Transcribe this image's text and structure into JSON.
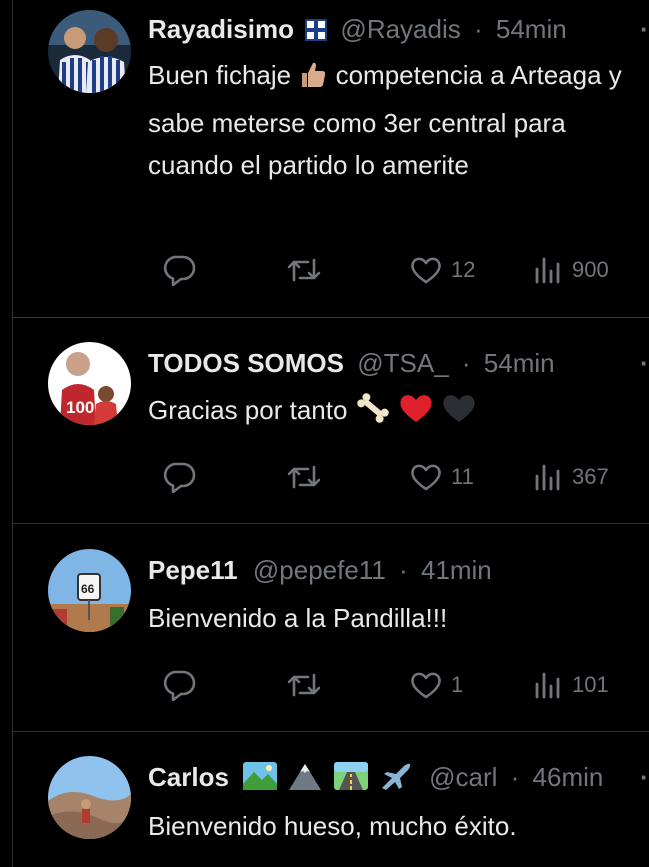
{
  "tweets": [
    {
      "name": "Rayadisimo",
      "handle": "@Rayadis",
      "dot": "·",
      "time": "54min",
      "text_a": "Buen fichaje",
      "text_b": "competencia a Arteaga y sabe meterse como 3er central para cuando el partido lo amerite",
      "replies": "",
      "retweets": "",
      "likes": "12",
      "views": "900"
    },
    {
      "name": "TODOS SOMOS",
      "handle": "@TSA_",
      "dot": "·",
      "time": "54min",
      "text_a": "Gracias por tanto",
      "text_b": "",
      "replies": "",
      "retweets": "",
      "likes": "11",
      "views": "367"
    },
    {
      "name": "Pepe11",
      "handle": "@pepefe11",
      "dot": "·",
      "time": "41min",
      "text_a": "Bienvenido a la Pandilla!!!",
      "text_b": "",
      "replies": "",
      "retweets": "",
      "likes": "1",
      "views": "101"
    },
    {
      "name": "Carlos",
      "handle": "@carl",
      "dot": "·",
      "time": "46min",
      "text_a": "Bienvenido hueso, mucho éxito.",
      "text_b": "",
      "replies": "",
      "retweets": "",
      "likes": "",
      "views": ""
    }
  ],
  "icons": {
    "reply": "reply-icon",
    "retweet": "retweet-icon",
    "like": "heart-icon",
    "views": "views-chart-icon",
    "more": "more-dots-icon"
  },
  "colors": {
    "background": "#000000",
    "text": "#e7e9ea",
    "secondary": "#71767b",
    "divider": "#2f3336"
  }
}
